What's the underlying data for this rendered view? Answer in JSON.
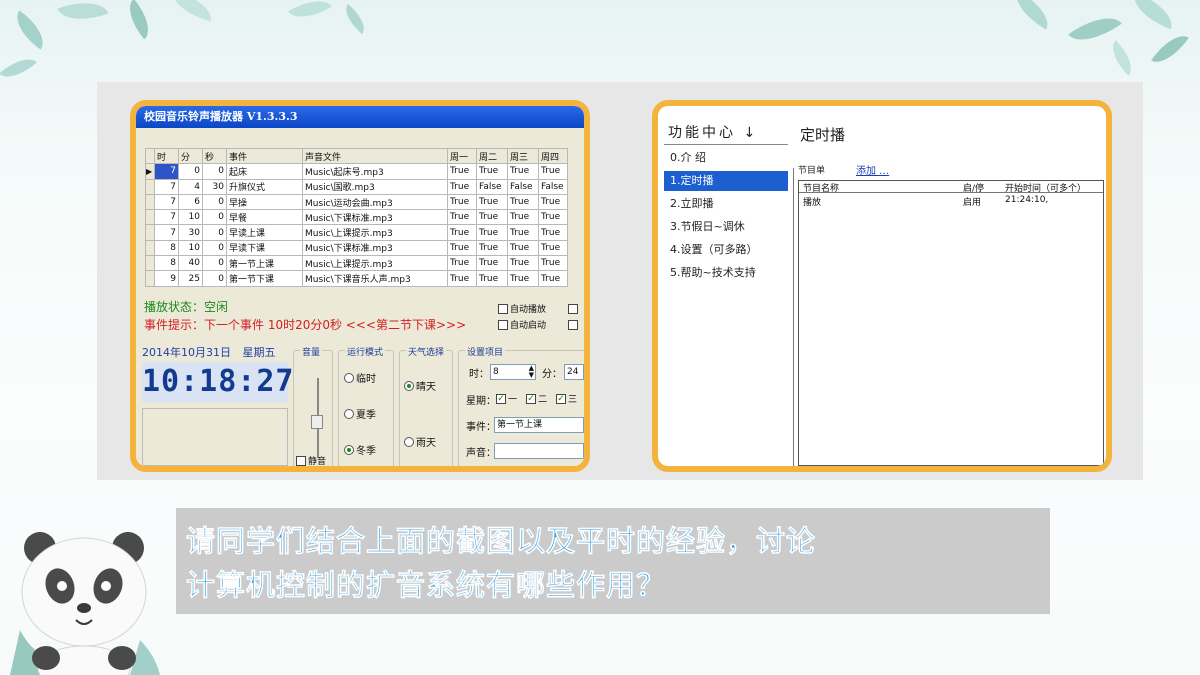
{
  "left_app": {
    "title": "校园音乐铃声播放器 V1.3.3.3",
    "table": {
      "headers": [
        "时",
        "分",
        "秒",
        "事件",
        "声音文件",
        "周一",
        "周二",
        "周三",
        "周四"
      ],
      "rows": [
        [
          "7",
          "0",
          "0",
          "起床",
          "Music\\起床号.mp3",
          "True",
          "True",
          "True",
          "True"
        ],
        [
          "7",
          "4",
          "30",
          "升旗仪式",
          "Music\\国歌.mp3",
          "True",
          "False",
          "False",
          "False"
        ],
        [
          "7",
          "6",
          "0",
          "早操",
          "Music\\运动会曲.mp3",
          "True",
          "True",
          "True",
          "True"
        ],
        [
          "7",
          "10",
          "0",
          "早餐",
          "Music\\下课标准.mp3",
          "True",
          "True",
          "True",
          "True"
        ],
        [
          "7",
          "30",
          "0",
          "早读上课",
          "Music\\上课提示.mp3",
          "True",
          "True",
          "True",
          "True"
        ],
        [
          "8",
          "10",
          "0",
          "早读下课",
          "Music\\下课标准.mp3",
          "True",
          "True",
          "True",
          "True"
        ],
        [
          "8",
          "40",
          "0",
          "第一节上课",
          "Music\\上课提示.mp3",
          "True",
          "True",
          "True",
          "True"
        ],
        [
          "9",
          "25",
          "0",
          "第一节下课",
          "Music\\下课音乐人声.mp3",
          "True",
          "True",
          "True",
          "True"
        ]
      ]
    },
    "status": "播放状态：空闲",
    "event_hint": "事件提示：下一个事件 10时20分0秒 <<<第二节下课>>>",
    "auto_play": "自动播放",
    "auto_start": "自动启动",
    "date": "2014年10月31日",
    "weekday": "星期五",
    "clock": "10:18:27",
    "volume_label": "音量",
    "mute_label": "静音",
    "run_mode": {
      "caption": "运行模式",
      "options": [
        "临时",
        "夏季",
        "冬季"
      ],
      "selected": "冬季"
    },
    "weather": {
      "caption": "天气选择",
      "options": [
        "晴天",
        "雨天"
      ],
      "selected": "晴天"
    },
    "settings": {
      "caption": "设置项目",
      "hour_label": "时：",
      "hour_value": "8",
      "minute_label": "分：",
      "minute_value": "24",
      "week_label": "星期：",
      "days": [
        "一",
        "二",
        "三"
      ],
      "event_label": "事件：",
      "event_value": "第一节上课",
      "sound_label": "声音："
    }
  },
  "right_app": {
    "menu_header": "功能中心",
    "menu_arrow": "↓",
    "menu_items": [
      "0.介 绍",
      "1.定时播",
      "2.立即播",
      "3.节假日~调休",
      "4.设置（可多路）",
      "5.帮助~技术支持"
    ],
    "active_item": "1.定时播",
    "page_title": "定时播",
    "program_list_label": "节目单",
    "add_link": "添加 …",
    "list_headers": [
      "节目名称",
      "启/停",
      "开始时间（可多个）"
    ],
    "list_rows": [
      [
        "播放",
        "启用",
        "21:24:10,"
      ]
    ]
  },
  "question": {
    "line1": "请同学们结合上面的截图以及平时的经验，讨论",
    "line2": "计算机控制的扩音系统有哪些作用？"
  },
  "colors": {
    "frame": "#f3b43e",
    "question_text": "#2ba0e8",
    "question_bg": "#cbcbcb",
    "status_green": "#1a8a1a",
    "event_red": "#d22020",
    "clock_text": "#123a8f"
  }
}
